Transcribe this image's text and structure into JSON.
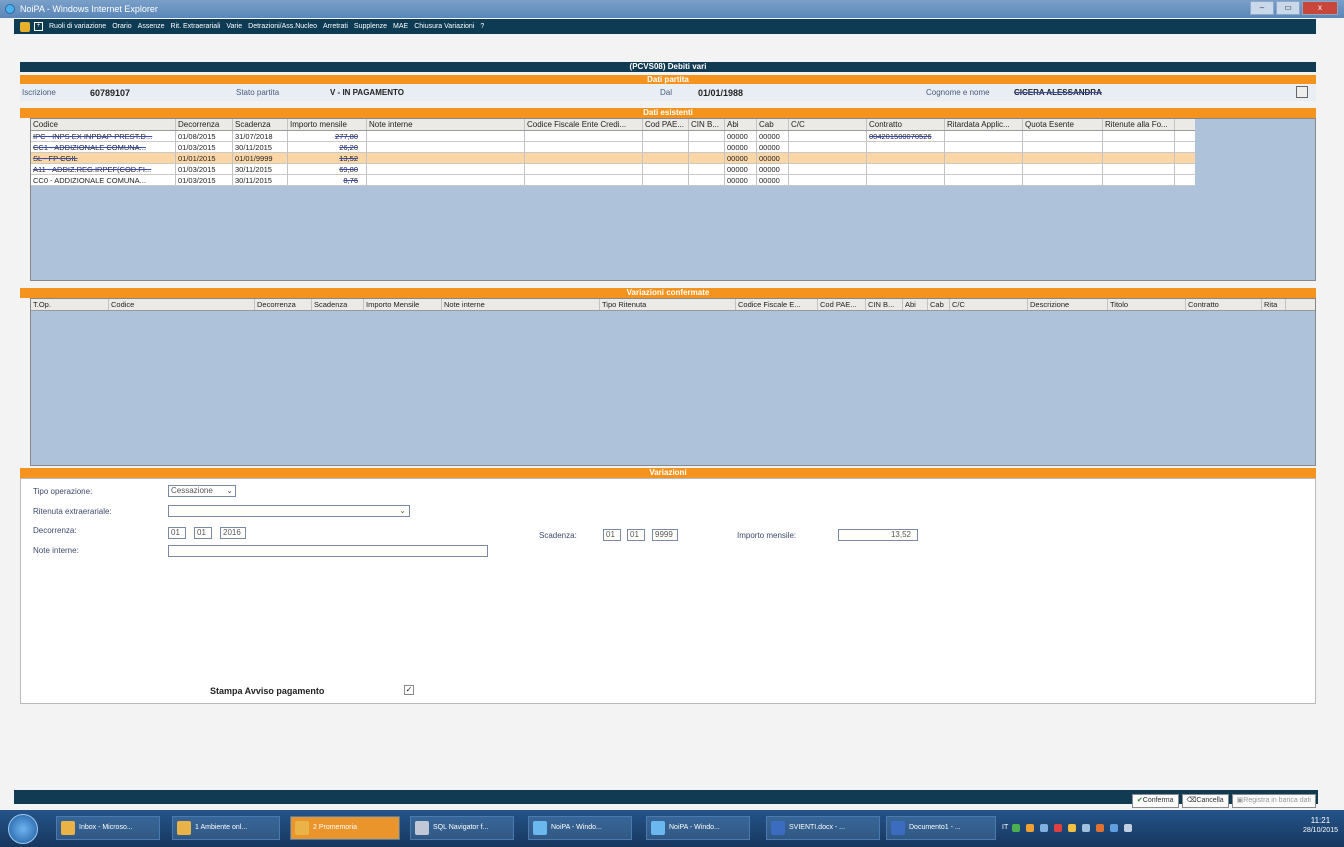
{
  "window": {
    "title": "NoiPA - Windows Internet Explorer",
    "buttons": [
      "–",
      "▭",
      "x"
    ]
  },
  "menu": [
    "Ruoli di variazione",
    "Orario",
    "Assenze",
    "Rit. Extraerariali",
    "Varie",
    "Detrazioni/Ass.Nucleo",
    "Arretrati",
    "Supplenze",
    "MAE",
    "Chiusura Variazioni",
    "?"
  ],
  "page": {
    "header": "(PCVS08) Debiti vari"
  },
  "dati_partita": {
    "title": "Dati partita",
    "iscrizione_label": "Iscrizione",
    "iscrizione_value": "60789107",
    "stato_label": "Stato partita",
    "stato_value": "V - IN PAGAMENTO",
    "dal_label": "Dal",
    "dal_value": "01/01/1988",
    "nome_label": "Cognome e nome",
    "nome_value": "CICERA ALESSANDRA"
  },
  "dati_esistenti": {
    "title": "Dati esistenti",
    "columns": [
      "Codice",
      "Decorrenza",
      "Scadenza",
      "Importo mensile",
      "Note interne",
      "Codice Fiscale Ente Credi...",
      "Cod PAE...",
      "CIN B...",
      "Abi",
      "Cab",
      "C/C",
      "Contratto",
      "Ritardata Applic...",
      "Quota Esente",
      "Ritenute alla Fo..."
    ],
    "rows": [
      [
        "IPC - INPS EX INPDAP-PREST.D...",
        "01/08/2015",
        "31/07/2018",
        "277,80",
        "",
        "",
        "",
        "",
        "00000",
        "00000",
        "",
        "004201500070526",
        "",
        "",
        ""
      ],
      [
        "CC1 - ADDIZIONALE COMUNA...",
        "01/03/2015",
        "30/11/2015",
        "26,20",
        "",
        "",
        "",
        "",
        "00000",
        "00000",
        "",
        "",
        "",
        "",
        ""
      ],
      [
        "SL - FP CGIL",
        "01/01/2015",
        "01/01/9999",
        "13,52",
        "",
        "",
        "",
        "",
        "00000",
        "00000",
        "",
        "",
        "",
        "",
        ""
      ],
      [
        "A11 - ADDIZ.REG.IRPEF(COD.FI...",
        "01/03/2015",
        "30/11/2015",
        "69,80",
        "",
        "",
        "",
        "",
        "00000",
        "00000",
        "",
        "",
        "",
        "",
        ""
      ],
      [
        "CC0 - ADDIZIONALE COMUNA...",
        "01/03/2015",
        "30/11/2015",
        "8,76",
        "",
        "",
        "",
        "",
        "00000",
        "00000",
        "",
        "",
        "",
        "",
        ""
      ]
    ]
  },
  "variazioni_confermate": {
    "title": "Variazioni confermate",
    "columns": [
      "T.Op.",
      "Codice",
      "Decorrenza",
      "Scadenza",
      "Importo Mensile",
      "Note interne",
      "Tipo Ritenuta",
      "Codice Fiscale E...",
      "Cod PAE...",
      "CIN B...",
      "Abi",
      "Cab",
      "C/C",
      "Descrizione",
      "Titolo",
      "Contratto",
      "Rita"
    ]
  },
  "variazioni": {
    "title": "Variazioni",
    "tipo_label": "Tipo operazione:",
    "tipo_value": "Cessazione",
    "ritenuta_label": "Ritenuta extraerariale:",
    "ritenuta_value": "",
    "decorrenza_label": "Decorrenza:",
    "dec_gg": "01",
    "dec_mm": "01",
    "dec_aaaa": "2016",
    "scadenza_label": "Scadenza:",
    "sca_gg": "01",
    "sca_mm": "01",
    "sca_aaaa": "9999",
    "importo_label": "Importo mensile:",
    "importo_value": "13,52",
    "note_label": "Note interne:",
    "note_value": "",
    "stampa_label": "Stampa Avviso pagamento"
  },
  "actions": {
    "conferma": "Conferma",
    "cancella": "Cancella",
    "registra": "Registra in banca dati"
  },
  "taskbar": {
    "items": [
      "Inbox - Microso...",
      "1 Ambiente onl...",
      "2 Promemoria",
      "SQL Navigator f...",
      "NoiPA - Windo...",
      "NoiPA - Windo...",
      "SVIENTI.docx - ...",
      "Documento1 - ..."
    ],
    "lang": "IT",
    "time": "11:21",
    "date": "28/10/2015"
  }
}
